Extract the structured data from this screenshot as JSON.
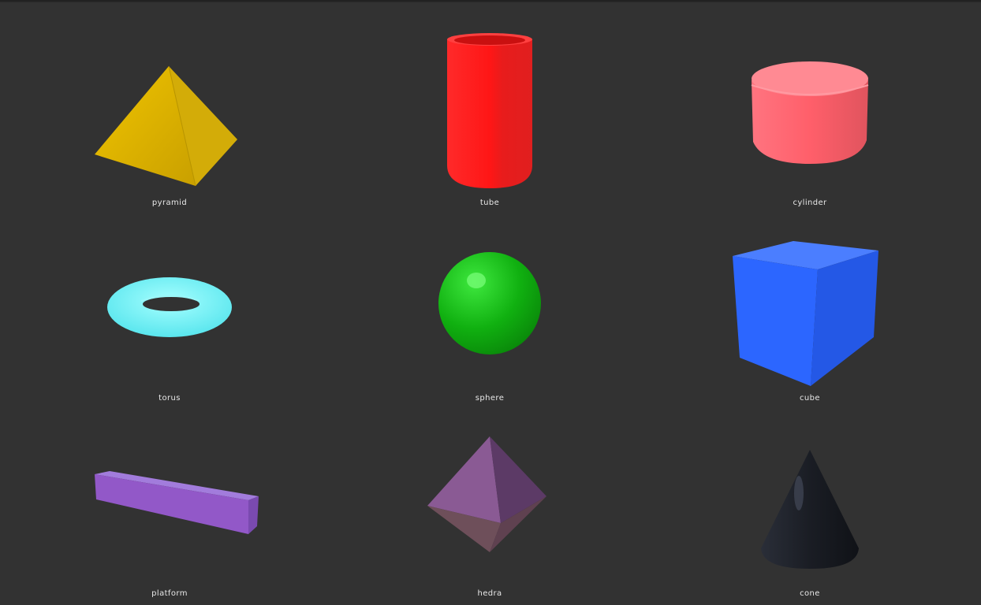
{
  "shapes": [
    {
      "label": "pyramid",
      "color": "#e0b800"
    },
    {
      "label": "tube",
      "color": "#ff1c1c"
    },
    {
      "label": "cylinder",
      "color": "#ff6670"
    },
    {
      "label": "torus",
      "color": "#6ff0f0"
    },
    {
      "label": "sphere",
      "color": "#16c016"
    },
    {
      "label": "cube",
      "color": "#2c66ff"
    },
    {
      "label": "platform",
      "color": "#9358c8"
    },
    {
      "label": "hedra",
      "color": "#7a4a82"
    },
    {
      "label": "cone",
      "color": "#1a1d24"
    }
  ]
}
